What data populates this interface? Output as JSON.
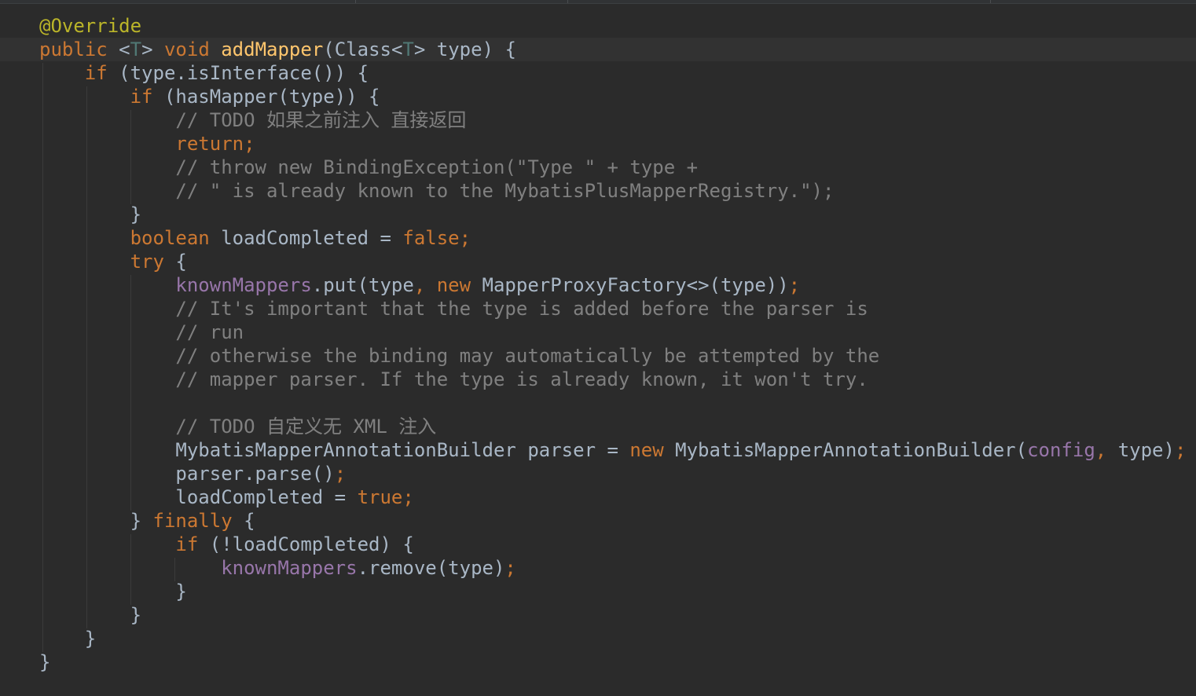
{
  "editor": {
    "lines": [
      [
        {
          "c": "ann",
          "t": "@Override"
        }
      ],
      [
        {
          "c": "kw",
          "t": "public "
        },
        {
          "c": "pl",
          "t": "<"
        },
        {
          "c": "tp",
          "t": "T"
        },
        {
          "c": "pl",
          "t": "> "
        },
        {
          "c": "kw",
          "t": "void "
        },
        {
          "c": "fn",
          "t": "addMapper"
        },
        {
          "c": "pl",
          "t": "(Class<"
        },
        {
          "c": "tp",
          "t": "T"
        },
        {
          "c": "pl",
          "t": "> type) {"
        }
      ],
      [
        {
          "c": "pl",
          "t": "    "
        },
        {
          "c": "kw",
          "t": "if "
        },
        {
          "c": "pl",
          "t": "(type.isInterface()) {"
        }
      ],
      [
        {
          "c": "pl",
          "t": "        "
        },
        {
          "c": "kw",
          "t": "if "
        },
        {
          "c": "pl",
          "t": "(hasMapper(type)) {"
        }
      ],
      [
        {
          "c": "pl",
          "t": "            "
        },
        {
          "c": "cm",
          "t": "// TODO 如果之前注入 直接返回"
        }
      ],
      [
        {
          "c": "pl",
          "t": "            "
        },
        {
          "c": "kw",
          "t": "return;"
        }
      ],
      [
        {
          "c": "pl",
          "t": "            "
        },
        {
          "c": "cm",
          "t": "// throw new BindingException(\"Type \" + type +"
        }
      ],
      [
        {
          "c": "pl",
          "t": "            "
        },
        {
          "c": "cm",
          "t": "// \" is already known to the MybatisPlusMapperRegistry.\");"
        }
      ],
      [
        {
          "c": "pl",
          "t": "        }"
        }
      ],
      [
        {
          "c": "pl",
          "t": "        "
        },
        {
          "c": "kw",
          "t": "boolean "
        },
        {
          "c": "pl",
          "t": "loadCompleted = "
        },
        {
          "c": "kw",
          "t": "false;"
        }
      ],
      [
        {
          "c": "pl",
          "t": "        "
        },
        {
          "c": "kw",
          "t": "try "
        },
        {
          "c": "pl",
          "t": "{"
        }
      ],
      [
        {
          "c": "pl",
          "t": "            "
        },
        {
          "c": "fld",
          "t": "knownMappers"
        },
        {
          "c": "pl",
          "t": ".put(type"
        },
        {
          "c": "kw",
          "t": ", new "
        },
        {
          "c": "pl",
          "t": "MapperProxyFactory<>(type))"
        },
        {
          "c": "kw",
          "t": ";"
        }
      ],
      [
        {
          "c": "pl",
          "t": "            "
        },
        {
          "c": "cm",
          "t": "// It's important that the type is added before the parser is"
        }
      ],
      [
        {
          "c": "pl",
          "t": "            "
        },
        {
          "c": "cm",
          "t": "// run"
        }
      ],
      [
        {
          "c": "pl",
          "t": "            "
        },
        {
          "c": "cm",
          "t": "// otherwise the binding may automatically be attempted by the"
        }
      ],
      [
        {
          "c": "pl",
          "t": "            "
        },
        {
          "c": "cm",
          "t": "// mapper parser. If the type is already known, it won't try."
        }
      ],
      [
        {
          "c": "pl",
          "t": ""
        }
      ],
      [
        {
          "c": "pl",
          "t": "            "
        },
        {
          "c": "cm",
          "t": "// TODO 自定义无 XML 注入"
        }
      ],
      [
        {
          "c": "pl",
          "t": "            MybatisMapperAnnotationBuilder parser = "
        },
        {
          "c": "kw",
          "t": "new "
        },
        {
          "c": "pl",
          "t": "MybatisMapperAnnotationBuilder("
        },
        {
          "c": "fld",
          "t": "config"
        },
        {
          "c": "kw",
          "t": ", "
        },
        {
          "c": "pl",
          "t": "type)"
        },
        {
          "c": "kw",
          "t": ";"
        }
      ],
      [
        {
          "c": "pl",
          "t": "            parser.parse()"
        },
        {
          "c": "kw",
          "t": ";"
        }
      ],
      [
        {
          "c": "pl",
          "t": "            loadCompleted = "
        },
        {
          "c": "kw",
          "t": "true;"
        }
      ],
      [
        {
          "c": "pl",
          "t": "        } "
        },
        {
          "c": "kw",
          "t": "finally "
        },
        {
          "c": "pl",
          "t": "{"
        }
      ],
      [
        {
          "c": "pl",
          "t": "            "
        },
        {
          "c": "kw",
          "t": "if "
        },
        {
          "c": "pl",
          "t": "(!loadCompleted) {"
        }
      ],
      [
        {
          "c": "pl",
          "t": "                "
        },
        {
          "c": "fld",
          "t": "knownMappers"
        },
        {
          "c": "pl",
          "t": ".remove(type)"
        },
        {
          "c": "kw",
          "t": ";"
        }
      ],
      [
        {
          "c": "pl",
          "t": "            }"
        }
      ],
      [
        {
          "c": "pl",
          "t": "        }"
        }
      ],
      [
        {
          "c": "pl",
          "t": "    }"
        }
      ],
      [
        {
          "c": "pl",
          "t": "}"
        }
      ]
    ]
  },
  "colors": {
    "background": "#2b2b2b",
    "keyword": "#cc7832",
    "annotation": "#bbb529",
    "method": "#ffc66d",
    "type_param": "#507874",
    "comment": "#808080",
    "field": "#9876aa",
    "plain": "#a9b7c6"
  }
}
